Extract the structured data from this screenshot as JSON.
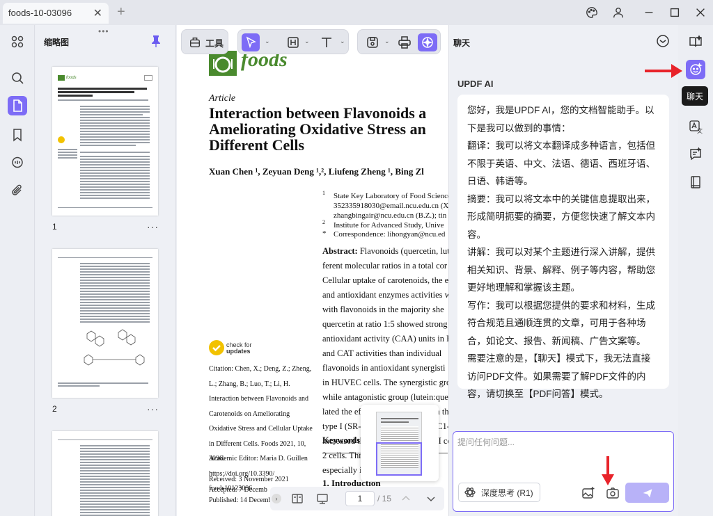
{
  "window": {
    "tab_title": "foods-10-03096",
    "new_tab": "+"
  },
  "thumbnails": {
    "title": "缩略图",
    "page_labels": [
      "1",
      "2"
    ],
    "more": "···"
  },
  "toolbar": {
    "tools_label": "工具"
  },
  "document": {
    "journal": "foods",
    "article_type": "Article",
    "title_lines": [
      "Interaction between Flavonoids a",
      "Ameliorating Oxidative Stress an",
      "Different Cells"
    ],
    "authors": "Xuan Chen ¹, Zeyuan Deng ¹,², Liufeng Zheng ¹, Bing Zl",
    "affil_marks": [
      "1",
      "2",
      "*"
    ],
    "affiliations": [
      "State Key Laboratory of Food Science",
      "352335918030@email.ncu.edu.cn (X.C",
      "zhangbingair@ncu.edu.cn (B.Z.); tin",
      "Institute for Advanced Study, Unive",
      "Correspondence: lihongyan@ncu.ed"
    ],
    "abstract_label": "Abstract:",
    "abstract_lines": [
      " Flavonoids (quercetin, lut",
      "ferent molecular ratios in a total cor",
      "Cellular uptake of carotenoids, the e",
      "and antioxidant enzymes activities w",
      "with flavonoids in the majority she",
      "quercetin at ratio 1:5 showed strong",
      "antioxidant activity (CAA) units in F",
      "and CAT activities than individual",
      "flavonoids in antioxidant synergisti",
      "in HUVEC cells. The synergistic grou",
      "while antagonistic group (lutein:que",
      "lated the effects of carotenoids on th",
      "type I (SR-BI) or Niemann-Pick C1-li",
      "increased the expression of SR-BI co",
      "2 cells.  Thr",
      "especially i"
    ],
    "keywords_label": "Keywords:",
    "check_updates": "check for updates",
    "check_for": "check for",
    "updates": "updates",
    "citation_lines": [
      "Citation:  Chen, X.; Deng, Z.; Zheng,",
      "L.; Zhang, B.; Luo, T.; Li, H.",
      "Interaction between Flavonoids and",
      "Carotenoids on Ameliorating",
      "Oxidative Stress and Cellular Uptake",
      "in Different Cells. Foods 2021, 10, 3096.",
      "https://doi.org/10.3390/",
      "foods10123096"
    ],
    "editor": "Academic Editor: Maria D. Guillen",
    "dates": [
      "Received: 3 November 2021",
      "Accepted: 7 Decemb",
      "Published: 14 Decemb"
    ],
    "intro": "1. Introduction"
  },
  "navbar": {
    "page": "1",
    "total": "/ 15"
  },
  "chat": {
    "title": "聊天",
    "ai_name": "UPDF AI",
    "messages": [
      "您好，我是UPDF AI，您的文档智能助手。以下是我可以做到的事情：",
      "翻译：我可以将文本翻译成多种语言，包括但不限于英语、中文、法语、德语、西班牙语、日语、韩语等。",
      "摘要：我可以将文本中的关键信息提取出来，形成简明扼要的摘要，方便您快速了解文本内容。",
      "讲解：我可以对某个主题进行深入讲解，提供相关知识、背景、解释、例子等内容，帮助您更好地理解和掌握该主题。",
      "写作：我可以根据您提供的要求和材料，生成符合规范且通顺连贯的文章，可用于各种场合，如论文、报告、新闻稿、广告文案等。",
      "需要注意的是，【聊天】模式下，我无法直接访问PDF文件。如果需要了解PDF文件的内容，请切换至【PDF问答】模式。"
    ],
    "input_placeholder": "提问任何问题...",
    "deep_think": "深度思考 (R1)"
  },
  "tooltip": "聊天",
  "colors": {
    "accent": "#7d6cf6",
    "arrow": "#e8232a",
    "journal_green": "#4a8a2e"
  }
}
